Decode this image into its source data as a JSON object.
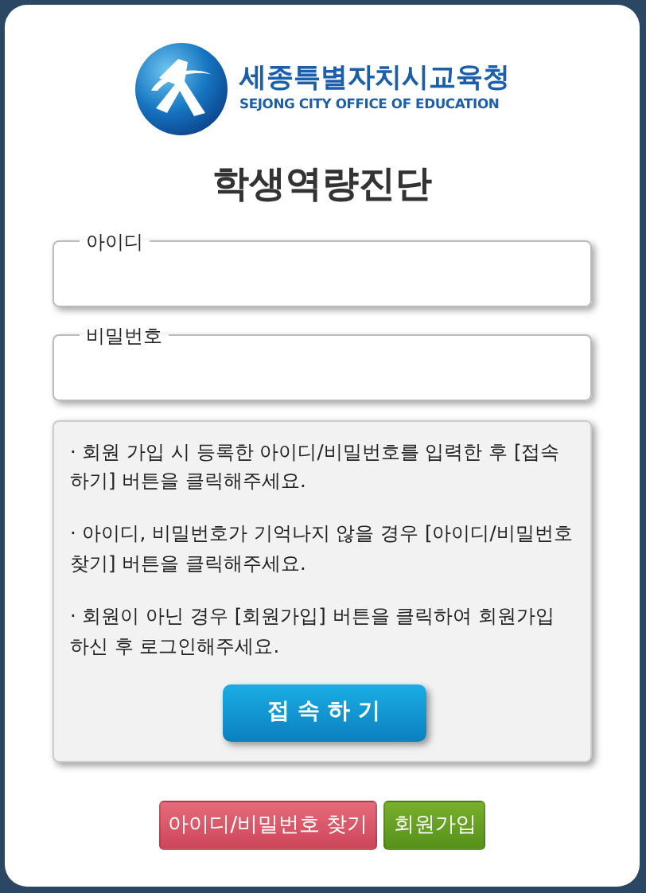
{
  "logo": {
    "name": "세종특별자치시교육청",
    "subtitle": "SEJONG CITY OFFICE OF EDUCATION"
  },
  "title": "학생역량진단",
  "fields": [
    {
      "label": "아이디"
    },
    {
      "label": "비밀번호"
    }
  ],
  "notes": [
    "· 회원 가입 시 등록한 아이디/비밀번호를 입력한 후 [접속하기] 버튼을 클릭해주세요.",
    "· 아이디, 비밀번호가 기억나지 않을 경우 [아이디/비밀번호 찾기] 버튼을 클릭해주세요.",
    "· 회원이 아닌 경우 [회원가입] 버튼을 클릭하여 회원가입 하신 후 로그인해주세요."
  ],
  "login_button": "접 속 하 기",
  "links": [
    {
      "label": "아이디/비밀번호 찾기",
      "kind": "find"
    },
    {
      "label": "회원가입",
      "kind": "join"
    }
  ]
}
